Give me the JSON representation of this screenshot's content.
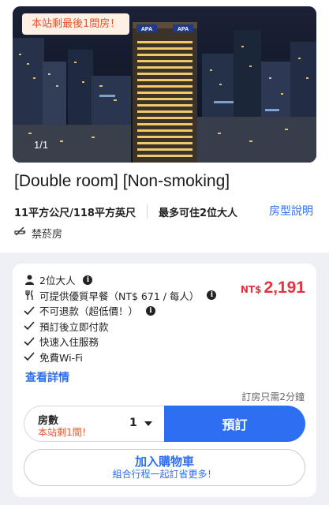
{
  "gallery": {
    "promo_badge": "本站剩最後1間房！",
    "counter": "1/1",
    "hotel_sign_left": "APA",
    "hotel_sign_right": "APA"
  },
  "room": {
    "title": "[Double room] [Non-smoking]",
    "size": "11平方公尺/118平方英尺",
    "capacity": "最多可住2位大人",
    "room_info_link": "房型說明",
    "smoking_policy": "禁菸房"
  },
  "offer": {
    "features": [
      {
        "icon": "person-icon",
        "text": "2位大人",
        "info": true
      },
      {
        "icon": "utensils-icon",
        "text": "可提供優質早餐（NT$ 671 / 每人）",
        "info": true
      },
      {
        "icon": "check-icon",
        "text": "不可退款（超低價！）",
        "info": true
      },
      {
        "icon": "check-icon",
        "text": "預訂後立即付款",
        "info": false
      },
      {
        "icon": "check-icon",
        "text": "快速入住服務",
        "info": false
      },
      {
        "icon": "check-icon",
        "text": "免費Wi-Fi",
        "info": false
      }
    ],
    "price_currency": "NT$",
    "price_amount": "2,191",
    "details_link": "查看詳情",
    "booking_time": "訂房只需2分鐘",
    "quantity_label": "房數",
    "quantity_left": "本站剩1間！",
    "quantity_value": "1",
    "book_button": "預訂",
    "cart_button": "加入購物車",
    "cart_subtext": "組合行程一起訂省更多！"
  },
  "colors": {
    "accent": "#2d6ff0",
    "price": "#e5323b",
    "urgent": "#e8542c"
  }
}
